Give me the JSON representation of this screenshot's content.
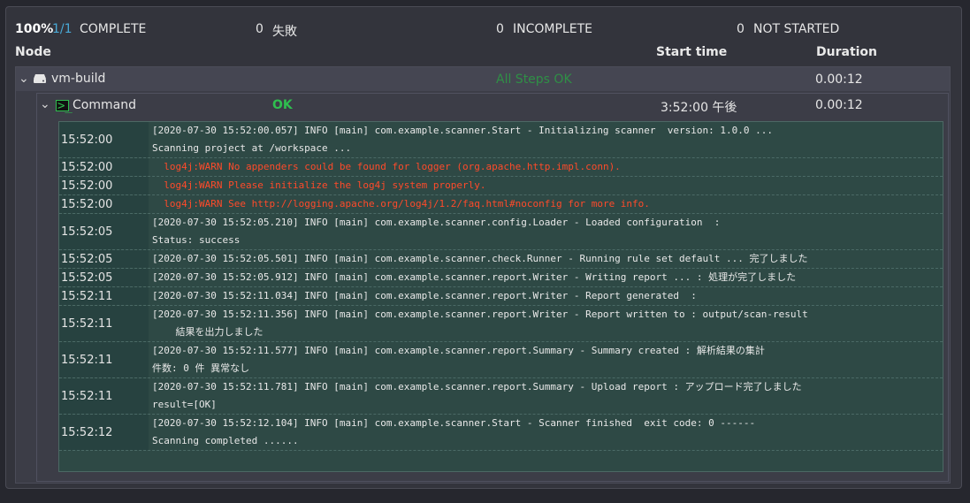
{
  "summary": {
    "percent": "100%",
    "ratio": "1/1",
    "complete_label": "COMPLETE",
    "failed_count": "0",
    "failed_label": "失敗",
    "incomplete_count": "0",
    "incomplete_label": "INCOMPLETE",
    "not_started_count": "0",
    "not_started_label": "NOT STARTED"
  },
  "columns": {
    "node": "Node",
    "start_time": "Start time",
    "duration": "Duration"
  },
  "node": {
    "name": "vm-build",
    "status": "All Steps OK",
    "duration": "0.00:12",
    "icon": "server-icon"
  },
  "step": {
    "name": "Command",
    "status": "OK",
    "start_time": "3:52:00 午後",
    "duration": "0.00:12",
    "icon": "terminal-icon"
  },
  "log": [
    {
      "time": "15:52:00",
      "level": "info",
      "text": "[2020-07-30 15:52:00.057] INFO [main] com.example.scanner.Start - Initializing scanner  version: 1.0.0 ...\nScanning project at /workspace ..."
    },
    {
      "time": "15:52:00",
      "level": "error",
      "text": "  log4j:WARN No appenders could be found for logger (org.apache.http.impl.conn).  "
    },
    {
      "time": "15:52:00",
      "level": "error",
      "text": "  log4j:WARN Please initialize the log4j system properly.  "
    },
    {
      "time": "15:52:00",
      "level": "error",
      "text": "  log4j:WARN See http://logging.apache.org/log4j/1.2/faq.html#noconfig for more info.  "
    },
    {
      "time": "15:52:05",
      "level": "info",
      "text": "[2020-07-30 15:52:05.210] INFO [main] com.example.scanner.config.Loader - Loaded configuration  :\nStatus: success"
    },
    {
      "time": "15:52:05",
      "level": "info",
      "text": "[2020-07-30 15:52:05.501] INFO [main] com.example.scanner.check.Runner - Running rule set default ... 完了しました"
    },
    {
      "time": "15:52:05",
      "level": "info",
      "text": "[2020-07-30 15:52:05.912] INFO [main] com.example.scanner.report.Writer - Writing report ... : 処理が完了しました"
    },
    {
      "time": "15:52:11",
      "level": "info",
      "text": "[2020-07-30 15:52:11.034] INFO [main] com.example.scanner.report.Writer - Report generated  :\n"
    },
    {
      "time": "15:52:11",
      "level": "info",
      "text": "[2020-07-30 15:52:11.356] INFO [main] com.example.scanner.report.Writer - Report written to : output/scan-result\n    結果を出力しました"
    },
    {
      "time": "15:52:11",
      "level": "info",
      "text": "[2020-07-30 15:52:11.577] INFO [main] com.example.scanner.report.Summary - Summary created : 解析結果の集計\n件数: 0 件 異常なし"
    },
    {
      "time": "15:52:11",
      "level": "info",
      "text": "[2020-07-30 15:52:11.781] INFO [main] com.example.scanner.report.Summary - Upload report : アップロード完了しました\nresult=[OK]"
    },
    {
      "time": "15:52:12",
      "level": "info",
      "text": "[2020-07-30 15:52:12.104] INFO [main] com.example.scanner.Start - Scanner finished  exit code: 0 ------\nScanning completed ......"
    }
  ]
}
